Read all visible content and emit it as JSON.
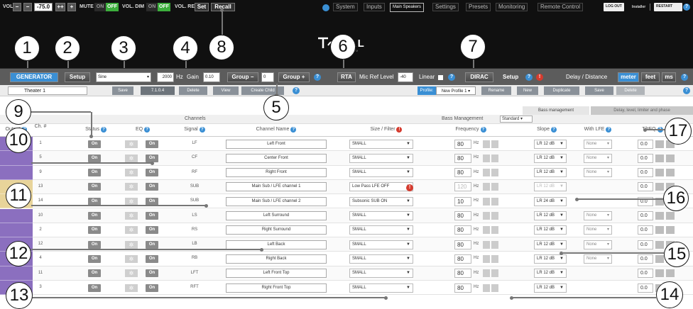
{
  "top": {
    "vol_label": "VOL",
    "vol_minus": "−",
    "vol_minus2": "−",
    "vol_value": "-75.0",
    "vol_plus2": "++",
    "vol_plus": "+",
    "mute_label": "MUTE",
    "mute_on": "ON",
    "mute_off": "OFF",
    "dim_label": "VOL. DIM",
    "dim_on": "ON",
    "dim_off": "OFF",
    "ref_label": "VOL. REF",
    "set": "Set",
    "recall": "Recall",
    "nav": [
      "System",
      "Inputs",
      "Main Speakers",
      "Settings",
      "Presets",
      "Monitoring",
      "Remote Control"
    ],
    "logout": "LOG OUT",
    "user": "Installer",
    "restart": "RESTART",
    "logo": "TRINNOV"
  },
  "toolbar": {
    "generator": "GENERATOR",
    "setup": "Setup",
    "signal": "Sine",
    "freq": "2000",
    "hz": "Hz",
    "gain_label": "Gain",
    "gain": "0.10",
    "group_minus": "Group −",
    "group_val": "0",
    "group_plus": "Group +",
    "rta": "RTA",
    "mic_ref_label": "Mic Ref Level",
    "mic_ref": "-40",
    "linear": "Linear",
    "dirac": "DIRAC",
    "dirac_setup": "Setup",
    "delay_label": "Delay / Distance",
    "meter": "meter",
    "feet": "feet",
    "ms": "ms"
  },
  "profilebar": {
    "theater": "Theater 1",
    "save": "Save",
    "format": "7.1.0.4",
    "delete": "Delete",
    "view": "View",
    "create_child": "Create Child",
    "profile_label": "Profile:",
    "profile_value": "New Profile 1",
    "rename": "Rename",
    "new": "New",
    "duplicate": "Duplicate",
    "save2": "Save",
    "delete2": "Delete"
  },
  "tabs": {
    "bass": "Bass management",
    "delay": "Delay, level, limiter and phase"
  },
  "groups": {
    "channels": "Channels",
    "bass_mgmt_label": "Bass Management",
    "bass_mgmt_value": "Standard"
  },
  "columns": {
    "output": "Output",
    "ch": "Ch. #",
    "status": "Status",
    "eq": "EQ",
    "signal": "Signal",
    "name": "Channel Name",
    "size": "Size / Filter",
    "frequency": "Frequency",
    "slope": "Slope",
    "with_lfe": "With LFE",
    "tilteq": "TiltEQ"
  },
  "rows": [
    {
      "ch": "1",
      "signal": "LF",
      "name": "Left Front",
      "size": "SMALL",
      "freq": "80",
      "slope": "LR 12 dB",
      "lfe": "None",
      "tilt": "0.0"
    },
    {
      "ch": "5",
      "signal": "CF",
      "name": "Center Front",
      "size": "SMALL",
      "freq": "80",
      "slope": "LR 12 dB",
      "lfe": "None",
      "tilt": "0.0"
    },
    {
      "ch": "9",
      "signal": "RF",
      "name": "Right Front",
      "size": "SMALL",
      "freq": "80",
      "slope": "LR 12 dB",
      "lfe": "None",
      "tilt": "0.0"
    },
    {
      "ch": "13",
      "signal": "SUB",
      "name": "Main Sub / LFE channel 1",
      "size": "Low Pass LFE OFF",
      "freq": "120",
      "slope": "LR 12 dB",
      "lfe": "",
      "tilt": "0.0"
    },
    {
      "ch": "14",
      "signal": "SUB",
      "name": "Main Sub / LFE channel 2",
      "size": "Subsonic SUB ON",
      "freq": "10",
      "slope": "LR 24 dB",
      "lfe": "",
      "tilt": "0.0"
    },
    {
      "ch": "10",
      "signal": "LS",
      "name": "Left Surround",
      "size": "SMALL",
      "freq": "80",
      "slope": "LR 12 dB",
      "lfe": "None",
      "tilt": "0.0"
    },
    {
      "ch": "2",
      "signal": "RS",
      "name": "Right Surround",
      "size": "SMALL",
      "freq": "80",
      "slope": "LR 12 dB",
      "lfe": "None",
      "tilt": "0.0"
    },
    {
      "ch": "12",
      "signal": "LB",
      "name": "Left Back",
      "size": "SMALL",
      "freq": "80",
      "slope": "LR 12 dB",
      "lfe": "None",
      "tilt": "0.0"
    },
    {
      "ch": "4",
      "signal": "RB",
      "name": "Right Back",
      "size": "SMALL",
      "freq": "80",
      "slope": "LR 12 dB",
      "lfe": "None",
      "tilt": "0.0"
    },
    {
      "ch": "11",
      "signal": "LFT",
      "name": "Left Front Top",
      "size": "SMALL",
      "freq": "80",
      "slope": "LR 12 dB",
      "lfe": "",
      "tilt": "0.0"
    },
    {
      "ch": "3",
      "signal": "RFT",
      "name": "Right Front Top",
      "size": "SMALL",
      "freq": "80",
      "slope": "LR 12 dB",
      "lfe": "",
      "tilt": "0.0"
    }
  ],
  "on_label": "On",
  "callouts": [
    "1",
    "2",
    "3",
    "4",
    "5",
    "6",
    "7",
    "8",
    "9",
    "10",
    "11",
    "12",
    "13",
    "14",
    "15",
    "16",
    "17"
  ],
  "colors": {
    "accent": "#3a8fd4",
    "green": "#3cae3c",
    "purple": "#8b6fbf",
    "sub": "#e8d49a"
  }
}
